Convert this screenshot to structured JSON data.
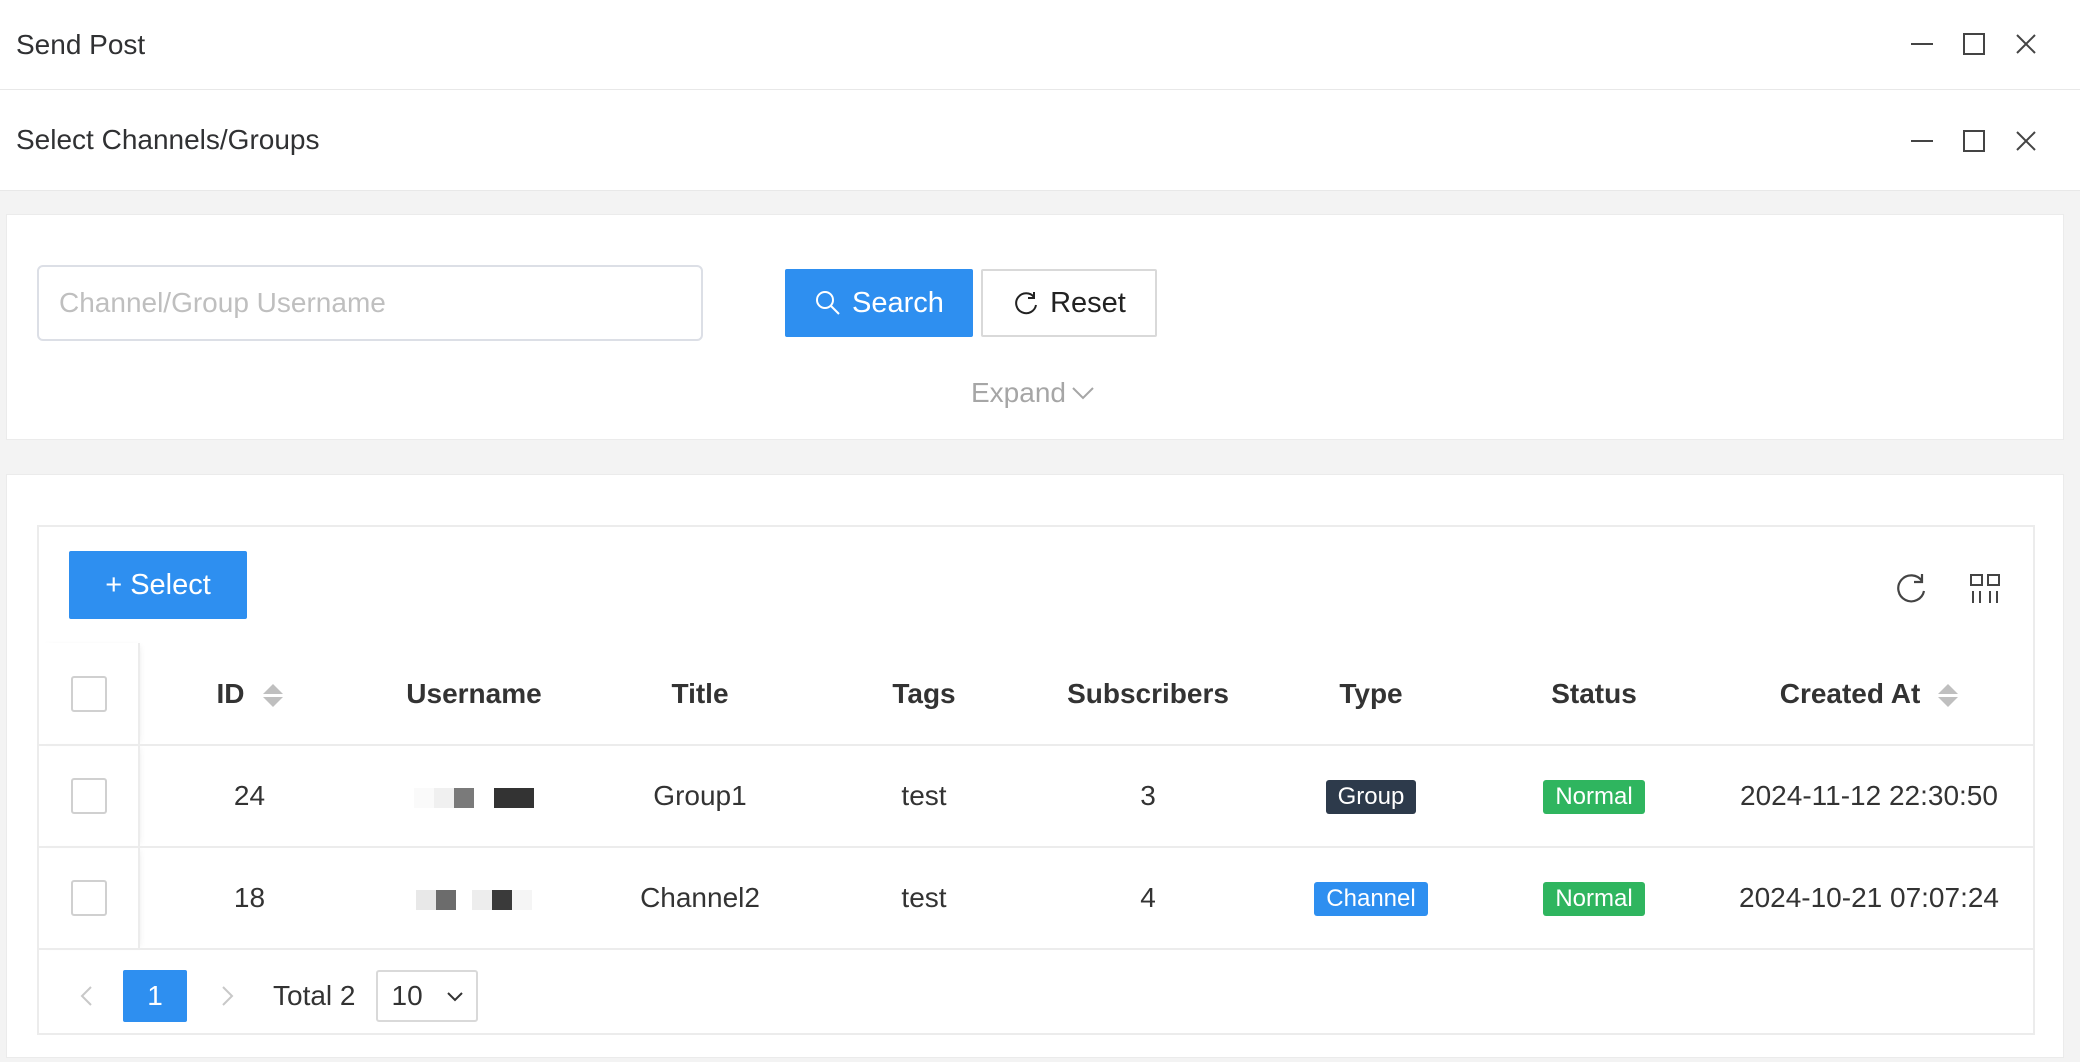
{
  "window": {
    "title": "Send Post",
    "subtitle": "Select Channels/Groups"
  },
  "search": {
    "placeholder": "Channel/Group Username",
    "search_label": "Search",
    "reset_label": "Reset",
    "expand_label": "Expand"
  },
  "toolbar": {
    "select_label": "+ Select"
  },
  "table": {
    "columns": [
      "ID",
      "Username",
      "Title",
      "Tags",
      "Subscribers",
      "Type",
      "Status",
      "Created At"
    ],
    "rows": [
      {
        "id": "24",
        "title": "Group1",
        "tags": "test",
        "subscribers": "3",
        "type": "Group",
        "status": "Normal",
        "created_at": "2024-11-12 22:30:50"
      },
      {
        "id": "18",
        "title": "Channel2",
        "tags": "test",
        "subscribers": "4",
        "type": "Channel",
        "status": "Normal",
        "created_at": "2024-10-21 07:07:24"
      }
    ]
  },
  "pagination": {
    "current_page": "1",
    "total_label": "Total 2",
    "page_size": "10"
  },
  "colors": {
    "primary": "#2e8ff0",
    "tag_group": "#2d3a4b",
    "tag_channel": "#2e8ff0",
    "status_normal": "#2fb55f"
  },
  "icons": [
    "minimize-icon",
    "maximize-icon",
    "close-icon",
    "search-icon",
    "refresh-icon",
    "chevron-down-icon",
    "column-settings-icon",
    "sort-icon",
    "chevron-left-icon",
    "chevron-right-icon"
  ]
}
